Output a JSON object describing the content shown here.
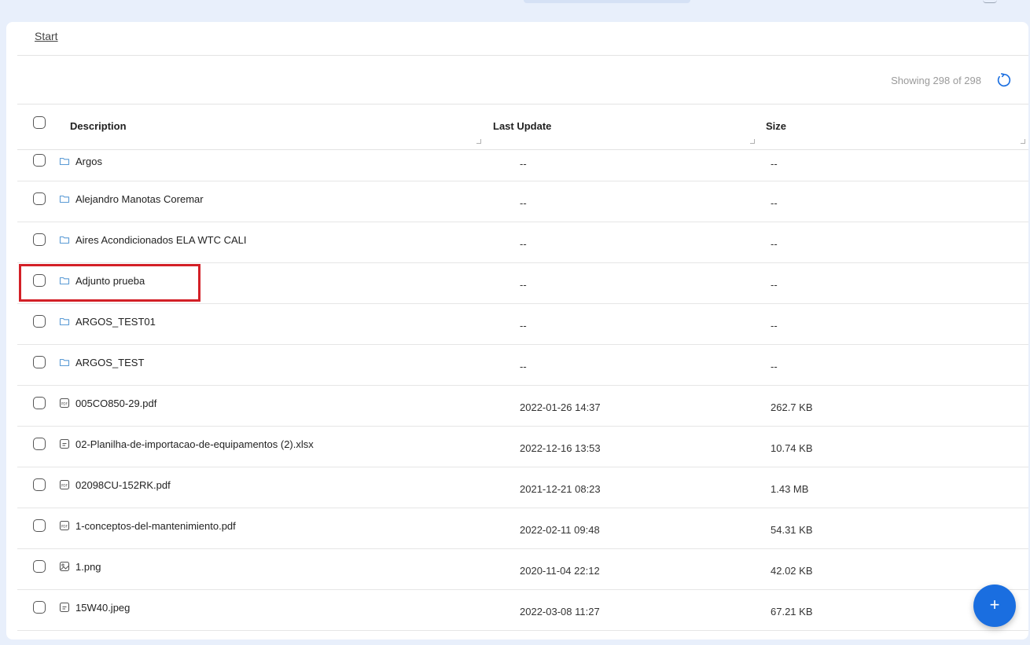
{
  "breadcrumb": {
    "label": "Start"
  },
  "toolbar": {
    "count_text": "Showing 298 of 298",
    "refresh_icon": "refresh-icon"
  },
  "table": {
    "columns": [
      "Description",
      "Last Update",
      "Size"
    ],
    "rows": [
      {
        "type": "folder",
        "icon": "folder-icon",
        "name": "Argos",
        "updated": "--",
        "size": "--"
      },
      {
        "type": "folder",
        "icon": "folder-icon",
        "name": "Alejandro Manotas Coremar",
        "updated": "--",
        "size": "--"
      },
      {
        "type": "folder",
        "icon": "folder-icon",
        "name": "Aires Acondicionados ELA WTC CALI",
        "updated": "--",
        "size": "--"
      },
      {
        "type": "folder",
        "icon": "folder-icon",
        "name": "Adjunto prueba",
        "updated": "--",
        "size": "--"
      },
      {
        "type": "folder",
        "icon": "folder-icon",
        "name": "ARGOS_TEST01",
        "updated": "--",
        "size": "--"
      },
      {
        "type": "folder",
        "icon": "folder-icon",
        "name": "ARGOS_TEST",
        "updated": "--",
        "size": "--"
      },
      {
        "type": "pdf",
        "icon": "pdf-file-icon",
        "name": "005CO850-29.pdf",
        "updated": "2022-01-26 14:37",
        "size": "262.7 KB"
      },
      {
        "type": "doc",
        "icon": "document-file-icon",
        "name": "02-Planilha-de-importacao-de-equipamentos (2).xlsx",
        "updated": "2022-12-16 13:53",
        "size": "10.74 KB"
      },
      {
        "type": "pdf",
        "icon": "pdf-file-icon",
        "name": "02098CU-152RK.pdf",
        "updated": "2021-12-21 08:23",
        "size": "1.43 MB"
      },
      {
        "type": "pdf",
        "icon": "pdf-file-icon",
        "name": "1-conceptos-del-mantenimiento.pdf",
        "updated": "2022-02-11 09:48",
        "size": "54.31 KB"
      },
      {
        "type": "image",
        "icon": "image-file-icon",
        "name": "1.png",
        "updated": "2020-11-04 22:12",
        "size": "42.02 KB"
      },
      {
        "type": "doc",
        "icon": "document-file-icon",
        "name": "15W40.jpeg",
        "updated": "2022-03-08 11:27",
        "size": "67.21 KB"
      }
    ]
  },
  "fab": {
    "label": "+"
  },
  "colors": {
    "accent": "#1a6ee0",
    "highlight": "#d32027",
    "folder": "#5b9bd5",
    "background": "#e8effb"
  }
}
